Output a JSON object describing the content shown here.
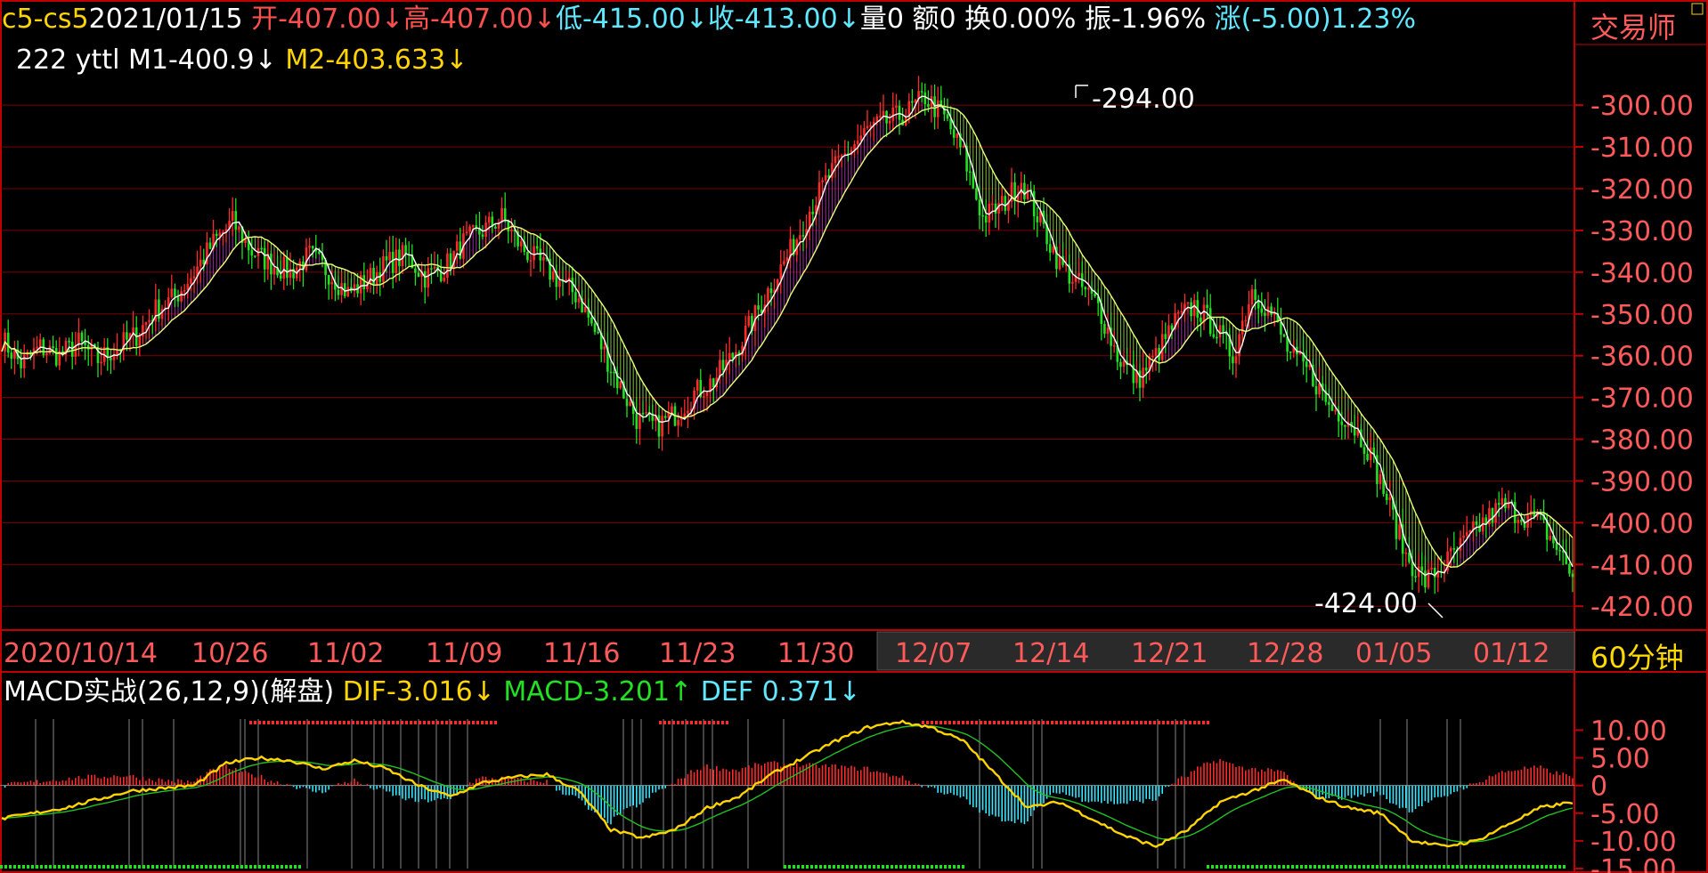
{
  "header": {
    "symbol": "c5-cs5",
    "date": "2021/01/15",
    "open": "开-407.00↓",
    "high": "高-407.00↓",
    "low": "低-415.00↓",
    "close": "收-413.00↓",
    "volume": "量0",
    "amount": "额0",
    "turnover": "换0.00%",
    "amplitude": "振-1.96%",
    "change": "涨(-5.00)1.23%"
  },
  "brand": "交易师",
  "indicators": {
    "name": "222 yttl",
    "m1": "M1-400.9↓",
    "m2": "M2-403.633↓"
  },
  "period_label": "60分钟",
  "macd_header": {
    "title": "MACD实战(26,12,9)(解盘)",
    "dif": "DIF-3.016↓",
    "macd": "MACD-3.201↑",
    "def": "DEF 0.371↓"
  },
  "colors": {
    "up": "#ff2a2a",
    "down": "#22e022",
    "bull_fill": "#d040d0",
    "bear_fill": "#a8ff50",
    "grid": "#7a0000",
    "axis_text": "#ff5a5a",
    "dif": "#ffd400",
    "dea": "#22c022",
    "macd_neg": "#33e5ff"
  },
  "chart_data": [
    {
      "type": "candlestick",
      "ylim": [
        -424,
        -294
      ],
      "y_ticks": [
        "-300.00",
        "-310.00",
        "-320.00",
        "-330.00",
        "-340.00",
        "-350.00",
        "-360.00",
        "-370.00",
        "-380.00",
        "-390.00",
        "-400.00",
        "-410.00",
        "-420.00"
      ],
      "x_ticks": [
        "2020/10/14",
        "10/26",
        "11/02",
        "11/09",
        "11/16",
        "11/23",
        "11/30",
        "12/07",
        "12/14",
        "12/21",
        "12/28",
        "01/05",
        "01/12"
      ],
      "annotations": {
        "max_label": "-294.00",
        "min_label": "-424.00"
      },
      "price_path": [
        [
          0,
          -356
        ],
        [
          6,
          -362
        ],
        [
          12,
          -358
        ],
        [
          18,
          -360
        ],
        [
          24,
          -357
        ],
        [
          30,
          -361
        ],
        [
          36,
          -358
        ],
        [
          42,
          -355
        ],
        [
          48,
          -349
        ],
        [
          54,
          -346
        ],
        [
          60,
          -340
        ],
        [
          66,
          -333
        ],
        [
          72,
          -328
        ],
        [
          78,
          -335
        ],
        [
          84,
          -338
        ],
        [
          90,
          -340
        ],
        [
          96,
          -336
        ],
        [
          102,
          -340
        ],
        [
          108,
          -345
        ],
        [
          114,
          -342
        ],
        [
          120,
          -338
        ],
        [
          126,
          -336
        ],
        [
          132,
          -341
        ],
        [
          138,
          -339
        ],
        [
          144,
          -333
        ],
        [
          150,
          -330
        ],
        [
          156,
          -327
        ],
        [
          162,
          -334
        ],
        [
          168,
          -338
        ],
        [
          174,
          -342
        ],
        [
          180,
          -346
        ],
        [
          186,
          -356
        ],
        [
          192,
          -366
        ],
        [
          198,
          -375
        ],
        [
          204,
          -377
        ],
        [
          210,
          -374
        ],
        [
          216,
          -369
        ],
        [
          222,
          -366
        ],
        [
          228,
          -360
        ],
        [
          234,
          -352
        ],
        [
          240,
          -343
        ],
        [
          246,
          -335
        ],
        [
          252,
          -325
        ],
        [
          258,
          -317
        ],
        [
          264,
          -311
        ],
        [
          270,
          -306
        ],
        [
          276,
          -304
        ],
        [
          282,
          -302
        ],
        [
          288,
          -298
        ],
        [
          294,
          -303
        ],
        [
          300,
          -312
        ],
        [
          306,
          -327
        ],
        [
          312,
          -324
        ],
        [
          318,
          -318
        ],
        [
          324,
          -328
        ],
        [
          330,
          -338
        ],
        [
          336,
          -343
        ],
        [
          342,
          -348
        ],
        [
          348,
          -360
        ],
        [
          354,
          -366
        ],
        [
          360,
          -360
        ],
        [
          366,
          -352
        ],
        [
          372,
          -348
        ],
        [
          378,
          -353
        ],
        [
          384,
          -360
        ],
        [
          390,
          -344
        ],
        [
          396,
          -350
        ],
        [
          402,
          -360
        ],
        [
          408,
          -364
        ],
        [
          414,
          -372
        ],
        [
          420,
          -375
        ],
        [
          426,
          -382
        ],
        [
          432,
          -394
        ],
        [
          438,
          -408
        ],
        [
          444,
          -414
        ],
        [
          450,
          -410
        ],
        [
          456,
          -405
        ],
        [
          462,
          -400
        ],
        [
          468,
          -396
        ],
        [
          474,
          -398
        ],
        [
          480,
          -400
        ],
        [
          486,
          -407
        ],
        [
          490,
          -413
        ]
      ],
      "m1_line": "moving average 1 (white)",
      "m2_line": "moving average 2 (yellow-green)"
    },
    {
      "type": "bar",
      "name": "MACD",
      "ylim": [
        -15,
        12
      ],
      "y_ticks": [
        "10.00",
        "5.00",
        "0",
        "-5.00",
        "-10.00",
        "-15.00"
      ],
      "dif_path": [
        [
          0,
          -6
        ],
        [
          20,
          -4
        ],
        [
          40,
          -1
        ],
        [
          60,
          0
        ],
        [
          70,
          4
        ],
        [
          80,
          5
        ],
        [
          90,
          4.5
        ],
        [
          100,
          3
        ],
        [
          110,
          4.5
        ],
        [
          120,
          3
        ],
        [
          130,
          0
        ],
        [
          140,
          -2
        ],
        [
          150,
          0.5
        ],
        [
          160,
          1.5
        ],
        [
          170,
          2
        ],
        [
          180,
          -1
        ],
        [
          190,
          -8
        ],
        [
          200,
          -9.5
        ],
        [
          210,
          -8
        ],
        [
          220,
          -4
        ],
        [
          230,
          -2
        ],
        [
          240,
          2
        ],
        [
          250,
          5
        ],
        [
          260,
          8
        ],
        [
          270,
          10.5
        ],
        [
          280,
          11.5
        ],
        [
          290,
          10.5
        ],
        [
          300,
          8
        ],
        [
          310,
          2
        ],
        [
          320,
          -4
        ],
        [
          330,
          -3
        ],
        [
          340,
          -6
        ],
        [
          350,
          -9
        ],
        [
          360,
          -11
        ],
        [
          370,
          -8
        ],
        [
          380,
          -3
        ],
        [
          390,
          -1
        ],
        [
          400,
          1
        ],
        [
          410,
          -2
        ],
        [
          420,
          -4
        ],
        [
          430,
          -5
        ],
        [
          440,
          -10
        ],
        [
          450,
          -11
        ],
        [
          460,
          -10
        ],
        [
          470,
          -7
        ],
        [
          480,
          -4
        ],
        [
          490,
          -3
        ]
      ]
    }
  ]
}
